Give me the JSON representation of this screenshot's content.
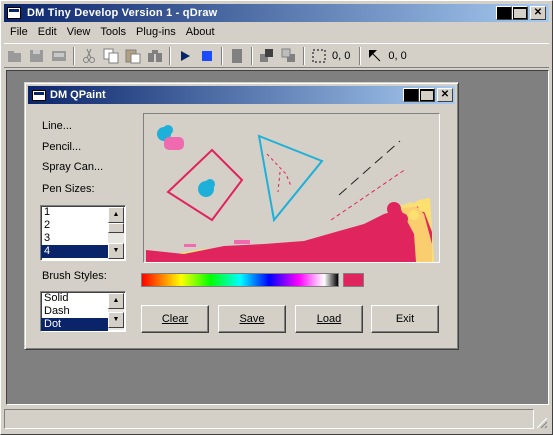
{
  "app": {
    "title": "DM Tiny Develop Version 1 - qDraw"
  },
  "menu": [
    "File",
    "Edit",
    "View",
    "Tools",
    "Plug-ins",
    "About"
  ],
  "toolbar": {
    "icons": [
      "open-folder-icon",
      "save-disk-icon",
      "print-icon",
      "cut-icon",
      "copy-icon",
      "paste-icon",
      "find-binoculars-icon",
      "run-icon",
      "stop-icon",
      "document-icon",
      "bring-front-icon",
      "send-back-icon",
      "select-rect-icon"
    ],
    "coord1": "0, 0",
    "coord2": "0, 0"
  },
  "child": {
    "title": "DM QPaint",
    "tools": [
      "Line...",
      "Pencil...",
      "Spray Can..."
    ],
    "pen_sizes_label": "Pen Sizes:",
    "pen_sizes": [
      "1",
      "2",
      "3",
      "4"
    ],
    "pen_selected": "4",
    "brush_styles_label": "Brush Styles:",
    "brush_styles": [
      "Solid",
      "Dash",
      "Dot"
    ],
    "brush_selected": "Dot",
    "buttons": {
      "clear": "Clear",
      "save": "Save",
      "load": "Load",
      "exit": "Exit"
    },
    "current_color": "#e0245e"
  },
  "colors": {
    "pink": "#e0245e",
    "cyan": "#1eb0d8",
    "yellow": "#fde070",
    "dark_line": "#222222"
  }
}
